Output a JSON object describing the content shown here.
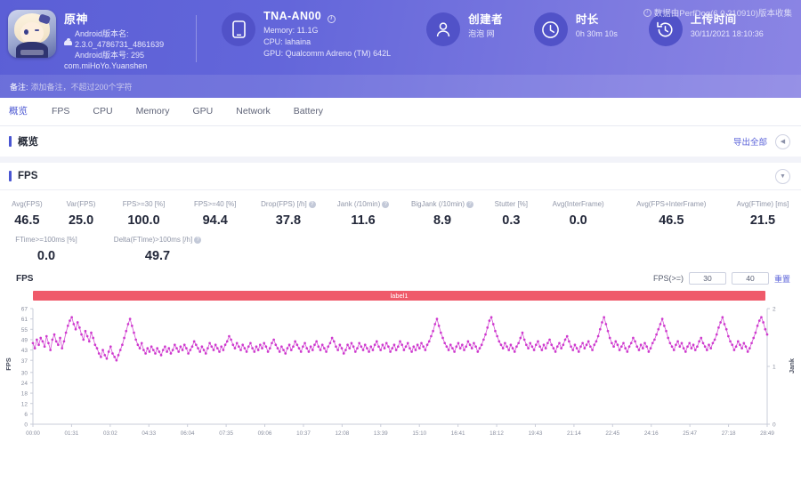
{
  "header": {
    "collect_note": "数据由PerfDog(6.0.210910)版本收集",
    "app": {
      "name": "原神",
      "android_version_name_label": "Android版本名:",
      "android_version_name": "2.3.0_4786731_4861639",
      "android_version_code": "Android版本号: 295",
      "package": "com.miHoYo.Yuanshen",
      "icon": "game-app-icon"
    },
    "device": {
      "icon": "phone-icon",
      "title": "TNA-AN00",
      "info_icon": "info-icon",
      "memory": "Memory: 11.1G",
      "cpu": "CPU: lahaina",
      "gpu": "GPU: Qualcomm Adreno (TM) 642L"
    },
    "creator": {
      "icon": "user-icon",
      "title": "创建者",
      "value": "泡泡 网"
    },
    "duration": {
      "icon": "clock-icon",
      "title": "时长",
      "value": "0h 30m 10s"
    },
    "upload": {
      "icon": "history-clock-icon",
      "title": "上传时间",
      "value": "30/11/2021 18:10:36"
    },
    "remark_label": "备注:",
    "remark_placeholder": "添加备注，不超过200个字符"
  },
  "tabs": [
    {
      "label": "概览",
      "active": true
    },
    {
      "label": "FPS",
      "active": false
    },
    {
      "label": "CPU",
      "active": false
    },
    {
      "label": "Memory",
      "active": false
    },
    {
      "label": "GPU",
      "active": false
    },
    {
      "label": "Network",
      "active": false
    },
    {
      "label": "Battery",
      "active": false
    }
  ],
  "overview": {
    "title": "概览",
    "export_label": "导出全部",
    "collapse_icon": "chevron-left-icon"
  },
  "fps_card": {
    "title": "FPS",
    "expand_icon": "chevron-down-icon",
    "metrics_row1": [
      {
        "label": "Avg(FPS)",
        "value": "46.5",
        "help": false
      },
      {
        "label": "Var(FPS)",
        "value": "25.0",
        "help": false
      },
      {
        "label": "FPS>=30 [%]",
        "value": "100.0",
        "help": false
      },
      {
        "label": "FPS>=40 [%]",
        "value": "94.4",
        "help": false
      },
      {
        "label": "Drop(FPS) [/h]",
        "value": "37.8",
        "help": true
      },
      {
        "label": "Jank (/10min)",
        "value": "11.6",
        "help": true
      },
      {
        "label": "BigJank (/10min)",
        "value": "8.9",
        "help": true
      },
      {
        "label": "Stutter [%]",
        "value": "0.3",
        "help": false
      },
      {
        "label": "Avg(InterFrame)",
        "value": "0.0",
        "help": false
      },
      {
        "label": "Avg(FPS+InterFrame)",
        "value": "46.5",
        "help": false
      },
      {
        "label": "Avg(FTime) [ms]",
        "value": "21.5",
        "help": false
      }
    ],
    "metrics_row2": [
      {
        "label": "FTime>=100ms [%]",
        "value": "0.0",
        "help": false
      },
      {
        "label": "Delta(FTime)>100ms [/h]",
        "value": "49.7",
        "help": true
      }
    ],
    "chart_name": "FPS",
    "fps_threshold_label": "FPS(>=)",
    "fps_threshold_1": "30",
    "fps_threshold_2": "40",
    "reset_label": "重置",
    "legend_label": "label1"
  },
  "colors": {
    "brand": "#5b5fd6",
    "accent": "#4a56d2",
    "legend_bar": "#ef5a6a",
    "series": "#cc33cc",
    "axis_text": "#8a8f9f"
  },
  "chart_data": {
    "type": "line",
    "title": "FPS",
    "xlabel": "",
    "ylabel": "FPS",
    "y2label": "Jank",
    "ylim": [
      0,
      67
    ],
    "y2lim": [
      0,
      2
    ],
    "grid": false,
    "legend_position": "top-center",
    "yticks": [
      0,
      6,
      12,
      18,
      24,
      30,
      37,
      43,
      49,
      55,
      61,
      67
    ],
    "y2ticks": [
      0,
      1,
      2
    ],
    "xticks": [
      "00:00",
      "01:31",
      "03:02",
      "04:33",
      "06:04",
      "07:35",
      "09:06",
      "10:37",
      "12:08",
      "13:39",
      "15:10",
      "16:41",
      "18:12",
      "19:43",
      "21:14",
      "22:45",
      "24:16",
      "25:47",
      "27:18",
      "28:49"
    ],
    "series": [
      {
        "name": "label1",
        "color": "#cc33cc",
        "marker": "circle",
        "values": [
          47,
          44,
          49,
          46,
          50,
          48,
          45,
          51,
          47,
          43,
          49,
          52,
          48,
          46,
          50,
          44,
          48,
          53,
          57,
          60,
          62,
          58,
          55,
          59,
          56,
          52,
          49,
          54,
          51,
          48,
          53,
          50,
          46,
          44,
          41,
          39,
          43,
          40,
          38,
          42,
          45,
          41,
          39,
          37,
          40,
          43,
          46,
          50,
          54,
          58,
          61,
          57,
          53,
          49,
          46,
          44,
          47,
          43,
          41,
          44,
          42,
          45,
          43,
          41,
          44,
          42,
          40,
          43,
          45,
          42,
          44,
          41,
          43,
          46,
          44,
          42,
          45,
          43,
          46,
          44,
          41,
          43,
          45,
          48,
          46,
          44,
          42,
          45,
          43,
          41,
          44,
          47,
          45,
          43,
          46,
          44,
          42,
          45,
          43,
          46,
          48,
          51,
          49,
          46,
          44,
          47,
          45,
          43,
          46,
          44,
          42,
          45,
          47,
          44,
          42,
          45,
          43,
          46,
          44,
          47,
          45,
          42,
          44,
          47,
          49,
          46,
          44,
          42,
          45,
          43,
          41,
          44,
          46,
          43,
          45,
          48,
          46,
          44,
          42,
          45,
          47,
          44,
          42,
          45,
          43,
          46,
          48,
          45,
          43,
          46,
          44,
          42,
          45,
          47,
          50,
          48,
          45,
          43,
          46,
          44,
          41,
          43,
          46,
          44,
          47,
          45,
          42,
          44,
          47,
          45,
          43,
          46,
          44,
          42,
          45,
          43,
          46,
          48,
          45,
          43,
          46,
          44,
          47,
          45,
          42,
          44,
          46,
          43,
          45,
          48,
          46,
          43,
          45,
          47,
          44,
          42,
          45,
          43,
          46,
          44,
          47,
          45,
          43,
          46,
          48,
          51,
          54,
          58,
          61,
          57,
          53,
          50,
          47,
          45,
          43,
          46,
          44,
          42,
          45,
          47,
          44,
          46,
          43,
          45,
          48,
          46,
          44,
          47,
          45,
          42,
          44,
          46,
          49,
          52,
          56,
          60,
          62,
          58,
          54,
          51,
          48,
          46,
          44,
          47,
          45,
          43,
          46,
          44,
          42,
          45,
          47,
          50,
          53,
          49,
          46,
          44,
          47,
          45,
          43,
          46,
          48,
          45,
          43,
          46,
          44,
          47,
          49,
          46,
          44,
          42,
          45,
          47,
          44,
          46,
          49,
          51,
          48,
          45,
          43,
          46,
          44,
          42,
          45,
          47,
          44,
          46,
          48,
          45,
          43,
          46,
          48,
          51,
          55,
          59,
          62,
          58,
          54,
          50,
          47,
          45,
          48,
          46,
          43,
          45,
          47,
          44,
          42,
          45,
          47,
          50,
          48,
          45,
          43,
          46,
          44,
          47,
          45,
          42,
          44,
          47,
          49,
          52,
          55,
          58,
          61,
          57,
          54,
          50,
          47,
          45,
          43,
          46,
          48,
          45,
          47,
          44,
          42,
          45,
          47,
          44,
          46,
          43,
          45,
          48,
          50,
          47,
          45,
          43,
          46,
          44,
          47,
          49,
          52,
          56,
          59,
          62,
          58,
          55,
          51,
          48,
          46,
          43,
          45,
          48,
          46,
          44,
          47,
          45,
          42,
          44,
          47,
          50,
          53,
          57,
          60,
          62,
          59,
          55,
          52
        ]
      }
    ]
  }
}
